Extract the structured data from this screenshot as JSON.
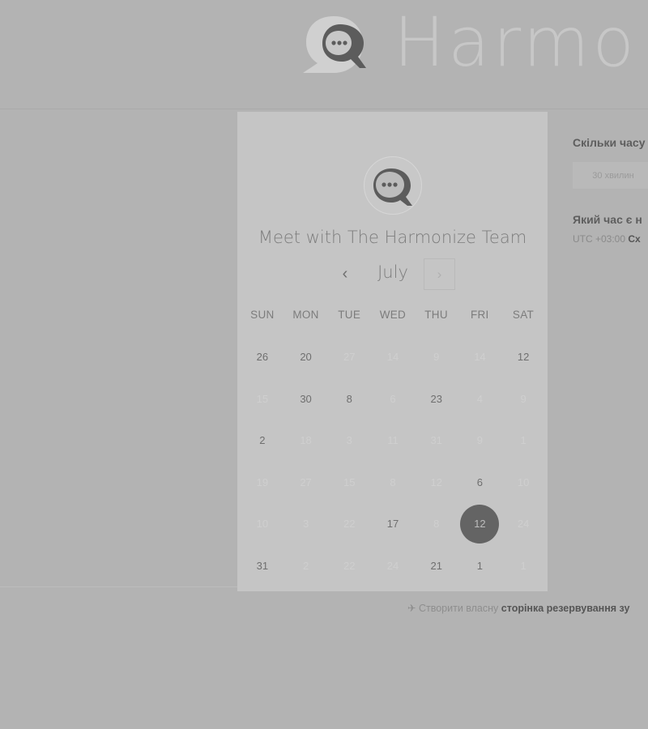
{
  "brand": {
    "name": "Harmo"
  },
  "calendar": {
    "title": "Meet with The Harmonize Team",
    "month": "July",
    "prev_icon": "‹",
    "next_icon": "›",
    "weekdays": [
      "SUN",
      "MON",
      "TUE",
      "WED",
      "THU",
      "FRI",
      "SAT"
    ],
    "days": [
      {
        "d": "26",
        "avail": true
      },
      {
        "d": "20",
        "avail": true
      },
      {
        "d": "27",
        "avail": false
      },
      {
        "d": "14",
        "avail": false
      },
      {
        "d": "9",
        "avail": false
      },
      {
        "d": "14",
        "avail": false
      },
      {
        "d": "12",
        "avail": true
      },
      {
        "d": "15",
        "avail": false
      },
      {
        "d": "30",
        "avail": true
      },
      {
        "d": "8",
        "avail": true
      },
      {
        "d": "6",
        "avail": false
      },
      {
        "d": "23",
        "avail": true
      },
      {
        "d": "4",
        "avail": false
      },
      {
        "d": "9",
        "avail": false
      },
      {
        "d": "2",
        "avail": true
      },
      {
        "d": "18",
        "avail": false
      },
      {
        "d": "3",
        "avail": false
      },
      {
        "d": "11",
        "avail": false
      },
      {
        "d": "31",
        "avail": false
      },
      {
        "d": "9",
        "avail": false
      },
      {
        "d": "1",
        "avail": false
      },
      {
        "d": "19",
        "avail": false
      },
      {
        "d": "27",
        "avail": false
      },
      {
        "d": "15",
        "avail": false
      },
      {
        "d": "8",
        "avail": false
      },
      {
        "d": "12",
        "avail": false
      },
      {
        "d": "6",
        "avail": true
      },
      {
        "d": "10",
        "avail": false
      },
      {
        "d": "10",
        "avail": false
      },
      {
        "d": "3",
        "avail": false
      },
      {
        "d": "22",
        "avail": false
      },
      {
        "d": "17",
        "avail": true
      },
      {
        "d": "8",
        "avail": false
      },
      {
        "d": "12",
        "avail": true,
        "selected": true
      },
      {
        "d": "24",
        "avail": false
      },
      {
        "d": "31",
        "avail": true
      },
      {
        "d": "2",
        "avail": false
      },
      {
        "d": "22",
        "avail": false
      },
      {
        "d": "24",
        "avail": false
      },
      {
        "d": "21",
        "avail": true
      },
      {
        "d": "1",
        "avail": true
      },
      {
        "d": "1",
        "avail": false
      }
    ]
  },
  "side": {
    "question_duration": "Скільки часу",
    "duration_option": "30 хвилин",
    "question_time": "Який час є н",
    "timezone_offset": "UTC +03:00",
    "timezone_name": "Сх"
  },
  "footer": {
    "icon": "✈",
    "text": "Створити власну",
    "link": "сторінка резервування зу"
  },
  "colors": {
    "background": "#b3b3b3",
    "panel": "#c5c5c5",
    "selected_day": "#646464"
  }
}
